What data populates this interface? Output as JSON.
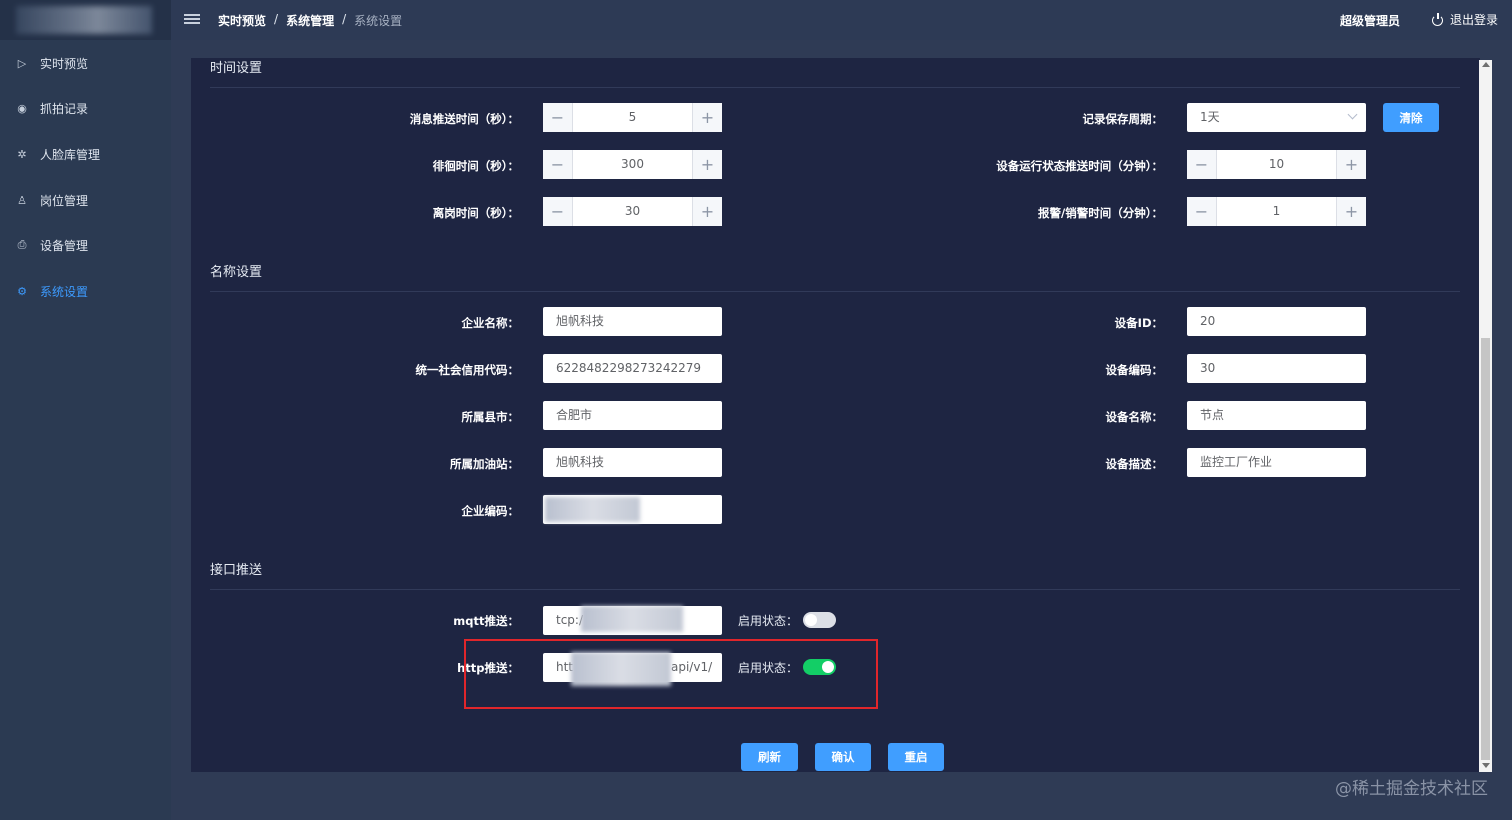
{
  "sidebar": {
    "items": [
      {
        "label": "实时预览",
        "icon": "play-circle-icon"
      },
      {
        "label": "抓拍记录",
        "icon": "camera-icon"
      },
      {
        "label": "人脸库管理",
        "icon": "gear-icon"
      },
      {
        "label": "岗位管理",
        "icon": "person-icon"
      },
      {
        "label": "设备管理",
        "icon": "printer-icon"
      },
      {
        "label": "系统设置",
        "icon": "settings-icon",
        "active": true
      }
    ]
  },
  "header": {
    "breadcrumb": [
      "实时预览",
      "系统管理",
      "系统设置"
    ],
    "separator": "/",
    "user": "超级管理员",
    "logout": "退出登录"
  },
  "time_settings": {
    "title": "时间设置",
    "push_interval": {
      "label": "消息推送时间（秒）：",
      "value": "5"
    },
    "linger_time": {
      "label": "徘徊时间（秒）：",
      "value": "300"
    },
    "absence_time": {
      "label": "离岗时间（秒）：",
      "value": "30"
    },
    "record_period": {
      "label": "记录保存周期：",
      "value": "1天"
    },
    "clear_button": "清除",
    "device_status_push": {
      "label": "设备运行状态推送时间（分钟）：",
      "value": "10"
    },
    "alarm_clear_time": {
      "label": "报警/销警时间（分钟）：",
      "value": "1"
    }
  },
  "name_settings": {
    "title": "名称设置",
    "company_name": {
      "label": "企业名称：",
      "value": "旭帆科技"
    },
    "credit_code": {
      "label": "统一社会信用代码：",
      "value": "6228482298273242279"
    },
    "city": {
      "label": "所属县市：",
      "value": "合肥市"
    },
    "gas_station": {
      "label": "所属加油站：",
      "value": "旭帆科技"
    },
    "company_code": {
      "label": "企业编码：",
      "value": ""
    },
    "device_id": {
      "label": "设备ID：",
      "value": "20"
    },
    "device_code": {
      "label": "设备编码：",
      "value": "30"
    },
    "device_name": {
      "label": "设备名称：",
      "value": "节点"
    },
    "device_desc": {
      "label": "设备描述：",
      "value": "监控工厂作业"
    }
  },
  "push_settings": {
    "title": "接口推送",
    "mqtt": {
      "label": "mqtt推送：",
      "value": "tcp:/",
      "status_label": "启用状态：",
      "enabled": false
    },
    "http": {
      "label": "http推送：",
      "value_prefix": "htt",
      "value_suffix": "api/v1/",
      "status_label": "启用状态：",
      "enabled": true
    }
  },
  "actions": {
    "refresh": "刷新",
    "confirm": "确认",
    "restart": "重启"
  },
  "watermark": "@稀土掘金技术社区",
  "colors": {
    "accent": "#409eff",
    "toggle_on": "#13ce66",
    "highlight": "#e0262b",
    "panel": "#1e2542"
  }
}
